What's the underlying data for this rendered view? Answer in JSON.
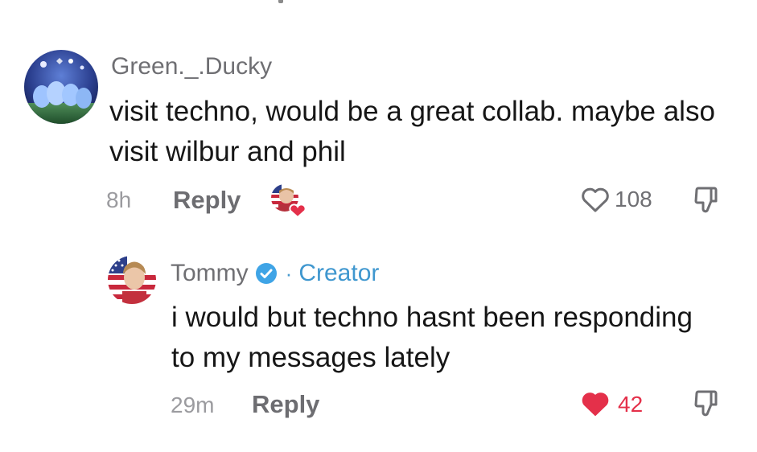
{
  "comments": [
    {
      "username": "Green._.Ducky",
      "text": "visit techno, would be a great collab. maybe also visit wilbur and phil",
      "time": "8h",
      "reply_label": "Reply",
      "like_count": "108",
      "liked": false,
      "liked_by_creator": true
    },
    {
      "username": "Tommy",
      "verified": true,
      "separator": "·",
      "badge": "Creator",
      "text": "i would but techno hasnt been responding to my messages lately",
      "time": "29m",
      "reply_label": "Reply",
      "like_count": "42",
      "liked": true
    }
  ],
  "icons": {
    "like": "heart-outline-icon",
    "liked": "heart-filled-icon",
    "dislike": "thumbs-down-icon",
    "verified": "verified-check-icon"
  },
  "colors": {
    "username": "#6f6f73",
    "body_text": "#161616",
    "timestamp": "#9b9b9f",
    "creator_badge": "#3f97cf",
    "like_active": "#e4304a"
  }
}
